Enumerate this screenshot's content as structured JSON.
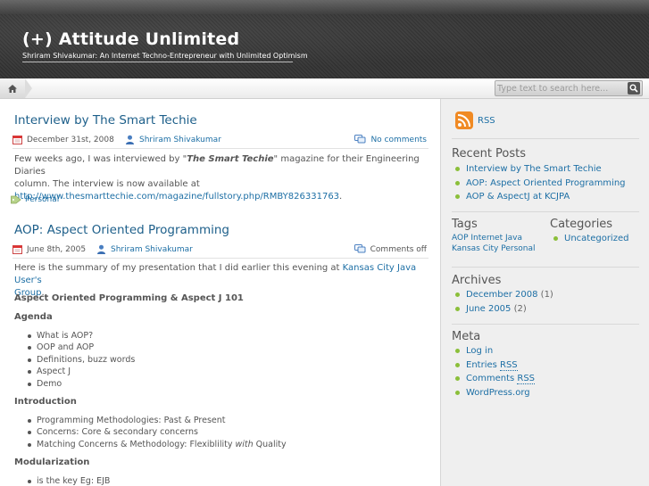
{
  "header": {
    "title": "(+) Attitude Unlimited",
    "description": "Shriram Shivakumar: An Internet Techno-Entrepreneur with Unlimited Optimism"
  },
  "nav": {
    "home_icon": "home-icon",
    "search_placeholder": "Type text to search here...",
    "search_icon": "magnifier-icon"
  },
  "posts": [
    {
      "title": "Interview by The Smart Techie",
      "date": "December 31st, 2008",
      "author": "Shriram Shivakumar",
      "comments": "No comments",
      "body_pre": "Few weeks ago, I was interviewed by \"",
      "body_em": "The Smart Techie",
      "body_post": "\" magazine for their Engineering Diaries",
      "body_line2": "column. The interview is now available at",
      "link": "http://www.thesmarttechie.com/magazine/fullstory.php/RMBY826331763",
      "link_suffix": ".",
      "tag": "Personal"
    },
    {
      "title": "AOP: Aspect Oriented Programming",
      "date": "June 8th, 2005",
      "author": "Shriram Shivakumar",
      "comments": "Comments off",
      "intro_pre": "Here is the summary of my presentation that I did earlier this evening at ",
      "intro_link1": "Kansas City Java User's",
      "intro_link2": "Group",
      "intro_post": ".",
      "heading_main": "Aspect Oriented Programming & Aspect J 101",
      "heading_agenda": "Agenda",
      "agenda": [
        "What is AOP?",
        "OOP and AOP",
        "Definitions, buzz words",
        "Aspect J",
        "Demo"
      ],
      "heading_intro": "Introduction",
      "intro_items": [
        "Programming Methodologies: Past & Present",
        "Concerns: Core & secondary concerns"
      ],
      "intro_item3_pre": "Matching Concerns & Methodology: Flexiblility ",
      "intro_item3_em": "with",
      "intro_item3_post": " Quality",
      "heading_mod": "Modularization",
      "mod_items": [
        "is the key Eg: EJB"
      ]
    }
  ],
  "sidebar": {
    "rss_label": "RSS",
    "recent_title": "Recent Posts",
    "recent": [
      "Interview by The Smart Techie",
      "AOP: Aspect Oriented Programming",
      "AOP & AspectJ at KCJPA"
    ],
    "tags_title": "Tags",
    "tags_line1": [
      "AOP",
      "Internet",
      "Java"
    ],
    "tags_line2": [
      "Kansas City",
      "Personal"
    ],
    "categories_title": "Categories",
    "categories": [
      "Uncategorized"
    ],
    "archives_title": "Archives",
    "archives": [
      {
        "label": "December 2008",
        "count": "(1)"
      },
      {
        "label": "June 2005",
        "count": "(2)"
      }
    ],
    "meta_title": "Meta",
    "meta": [
      {
        "label": "Log in",
        "abbr": ""
      },
      {
        "label": "Entries ",
        "abbr": "RSS"
      },
      {
        "label": "Comments ",
        "abbr": "RSS"
      },
      {
        "label": "WordPress.org",
        "abbr": ""
      }
    ]
  },
  "colors": {
    "link": "#1d6fa5",
    "bullet": "#8bbf3a",
    "rss": "#f08a24"
  }
}
